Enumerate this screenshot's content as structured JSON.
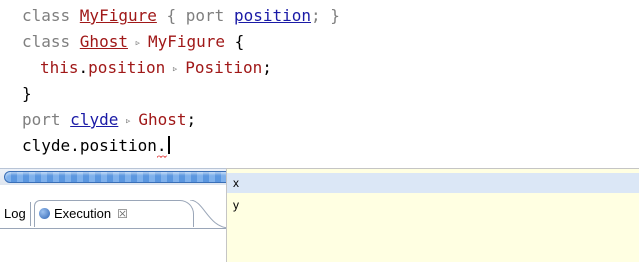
{
  "editor": {
    "line1": {
      "kw_class": "class ",
      "class_name": "MyFigure",
      "open": " { ",
      "kw_port": "port ",
      "port_name": "position",
      "close": "; }"
    },
    "line2": {
      "kw_class": "class ",
      "class_name": "Ghost",
      "arrow": "▹",
      "super_name": "MyFigure",
      "open": " {"
    },
    "line3": {
      "this": "this",
      "dot": ".",
      "field": "position",
      "arrow": "▹",
      "type": "Position",
      "semi": ";"
    },
    "line4": {
      "close": "}"
    },
    "line5": {
      "kw_port": "port ",
      "port_name": "clyde",
      "arrow": "▹",
      "type": "Ghost",
      "semi": ";"
    },
    "line6": {
      "obj": "clyde",
      "dot1": ".",
      "field": "position",
      "dot2": "."
    }
  },
  "panel": {
    "tab_log": "Log",
    "tab_execution": "Execution",
    "close_glyph": "☒",
    "execution_icon": "execution-icon"
  },
  "completion": {
    "items": [
      "x",
      "y"
    ],
    "selected_index": 0
  },
  "colors": {
    "class_ref": "#a01818",
    "port_ref": "#1a1aa6",
    "keyword": "#7f7f7f",
    "popup_bg": "#ffffe2",
    "selection": "#dbe7f6",
    "error_squiggle": "#e23a3a"
  }
}
